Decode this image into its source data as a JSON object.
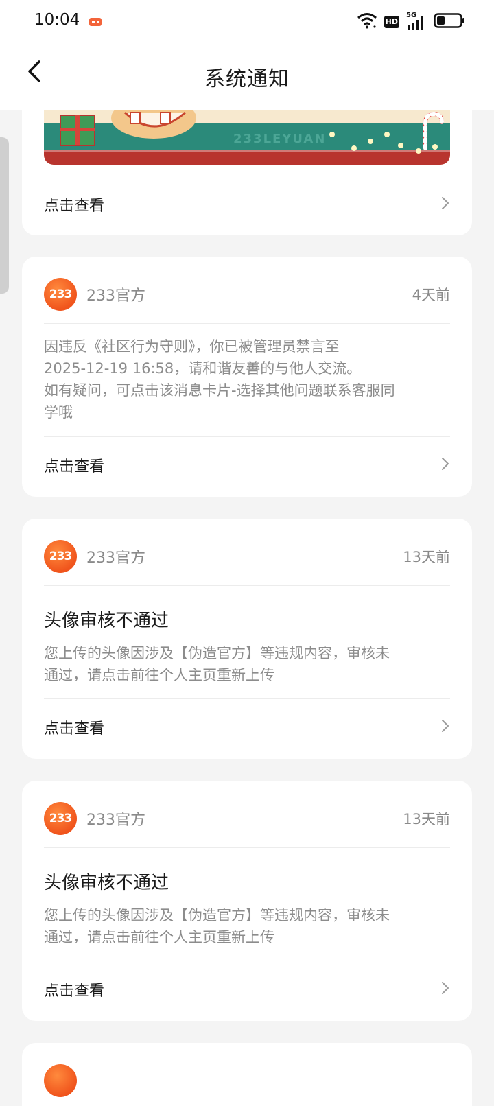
{
  "status_bar": {
    "time": "10:04",
    "app_icon": "game-notification-icon",
    "icons": [
      "wifi-icon",
      "hd-icon",
      "5g-signal-icon",
      "battery-icon"
    ],
    "hd_label": "HD",
    "network_label": "5G"
  },
  "nav": {
    "title": "系统通知",
    "back_icon": "chevron-left-icon"
  },
  "colors": {
    "accent": "#f0541c",
    "background": "#f4f4f4",
    "secondary_text": "#8a8a8a"
  },
  "banner": {
    "text": "233LEYUAN"
  },
  "cards": [
    {
      "cta": "点击查看"
    },
    {
      "sender": "233官方",
      "avatar_text": "233",
      "time": "4天前",
      "body_lines": [
        "因违反《社区行为守则》，你已被管理员禁言至",
        "2025-12-19 16:58，请和谐友善的与他人交流。",
        "如有疑问，可点击该消息卡片-选择其他问题联系客服同",
        "学哦"
      ],
      "cta": "点击查看"
    },
    {
      "sender": "233官方",
      "avatar_text": "233",
      "time": "13天前",
      "title": "头像审核不通过",
      "body_lines": [
        "您上传的头像因涉及【伪造官方】等违规内容，审核未",
        "通过，请点击前往个人主页重新上传"
      ],
      "cta": "点击查看"
    },
    {
      "sender": "233官方",
      "avatar_text": "233",
      "time": "13天前",
      "title": "头像审核不通过",
      "body_lines": [
        "您上传的头像因涉及【伪造官方】等违规内容，审核未",
        "通过，请点击前往个人主页重新上传"
      ],
      "cta": "点击查看"
    }
  ]
}
